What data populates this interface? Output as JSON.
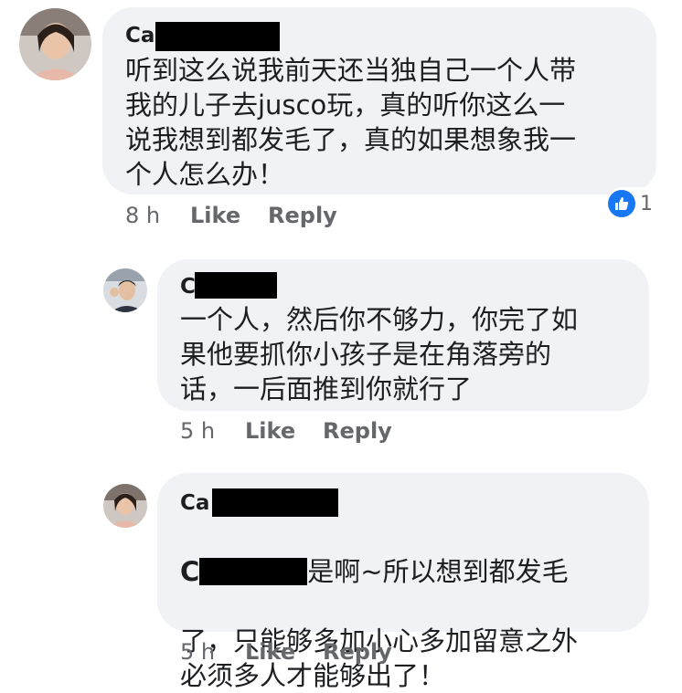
{
  "comments": [
    {
      "name": "Ca",
      "text": "听到这么说我前天还当独自己一个人带\n我的儿子去jusco玩，真的听你这么一\n说我想到都发毛了，真的如果想象我一\n个人怎么办！",
      "time": "8 h",
      "like_label": "Like",
      "reply_label": "Reply",
      "reaction_count": "1"
    },
    {
      "name": "C",
      "text": "一个人，然后你不够力，你完了如\n果他要抓你小孩子是在角落旁的\n话，一后面推到你就行了",
      "time": "5 h",
      "like_label": "Like",
      "reply_label": "Reply"
    },
    {
      "name": "Ca",
      "tag": "C",
      "text_first": "是啊~所以想到都发毛",
      "text_rest": "了，只能够多加小心多加留意之外\n必须多人才能够出了！",
      "time": "5 h",
      "like_label": "Like",
      "reply_label": "Reply"
    }
  ],
  "colors": {
    "bubble": "#f0f2f5",
    "meta": "#65676b",
    "like_badge": "#1877f2"
  }
}
